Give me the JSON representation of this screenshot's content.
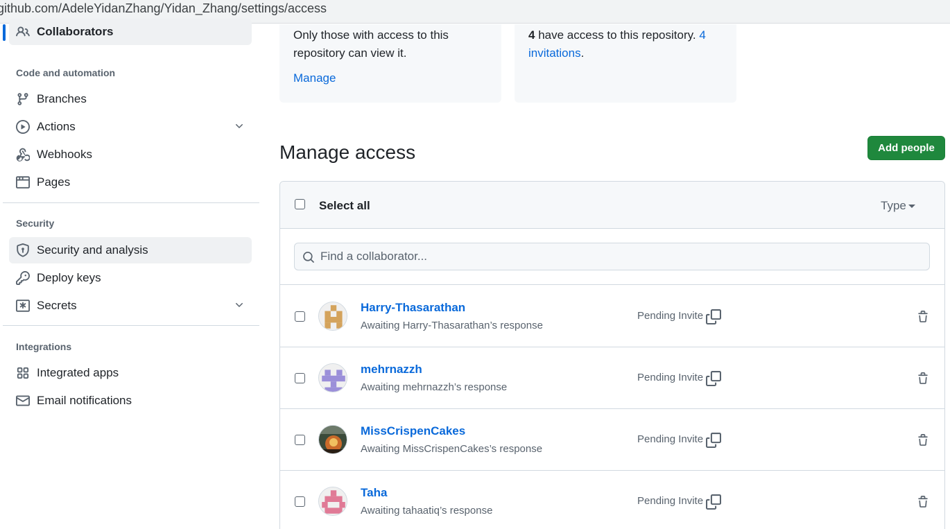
{
  "url": "github.com/AdeleYidanZhang/Yidan_Zhang/settings/access",
  "sidebar": {
    "active_item": "Collaborators",
    "sections": [
      {
        "heading": "Code and automation"
      },
      {
        "heading": "Security"
      },
      {
        "heading": "Integrations"
      }
    ],
    "items": [
      {
        "label": "Collaborators",
        "icon": "people-icon"
      },
      {
        "label": "Branches",
        "icon": "branch-icon"
      },
      {
        "label": "Actions",
        "icon": "play-icon"
      },
      {
        "label": "Webhooks",
        "icon": "webhook-icon"
      },
      {
        "label": "Pages",
        "icon": "browser-icon"
      },
      {
        "label": "Security and analysis",
        "icon": "shield-icon"
      },
      {
        "label": "Deploy keys",
        "icon": "key-icon"
      },
      {
        "label": "Secrets",
        "icon": "asterisk-icon"
      },
      {
        "label": "Integrated apps",
        "icon": "apps-icon"
      },
      {
        "label": "Email notifications",
        "icon": "mail-icon"
      }
    ]
  },
  "cards": {
    "visibility": {
      "text": "Only those with access to this repository can view it.",
      "link": "Manage"
    },
    "access": {
      "count": "4",
      "text": " have access to this repository. ",
      "link": "4 invitations",
      "suffix": "."
    }
  },
  "manage": {
    "title": "Manage access",
    "add_button": "Add people",
    "select_all": "Select all",
    "type_filter": "Type",
    "search_placeholder": "Find a collaborator..."
  },
  "collaborators": [
    {
      "name": "Harry-Thasarathan",
      "status": "Awaiting Harry-Thasarathan’s response",
      "role": "Pending Invite",
      "avatar_color": "#d4a35c"
    },
    {
      "name": "mehrnazzh",
      "status": "Awaiting mehrnazzh’s response",
      "role": "Pending Invite",
      "avatar_color": "#9b8fd9"
    },
    {
      "name": "MissCrispenCakes",
      "status": "Awaiting MissCrispenCakes’s response",
      "role": "Pending Invite",
      "avatar_color": "#5a4632"
    },
    {
      "name": "Taha",
      "status": "Awaiting tahaatiq’s response",
      "role": "Pending Invite",
      "avatar_color": "#e07a96"
    }
  ],
  "colors": {
    "accent": "#0969da",
    "button_green": "#1f883d",
    "muted": "#59636e",
    "border": "#d1d9e0"
  }
}
